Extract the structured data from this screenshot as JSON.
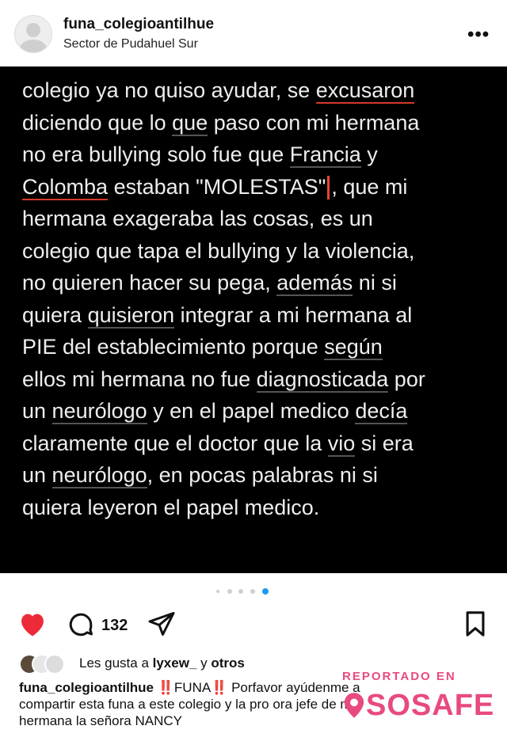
{
  "header": {
    "username": "funa_colegioantilhue",
    "location": "Sector de Pudahuel Sur",
    "more_label": "•••"
  },
  "post": {
    "lines": [
      [
        {
          "t": "colegio ya no quiso ayudar, se "
        },
        {
          "t": "excusaron",
          "s": "ur"
        }
      ],
      [
        {
          "t": "diciendo que lo "
        },
        {
          "t": "que",
          "s": "u"
        },
        {
          "t": " paso con mi hermana"
        }
      ],
      [
        {
          "t": "no era bullying solo fue que "
        },
        {
          "t": "Francia",
          "s": "u"
        },
        {
          "t": " y"
        }
      ],
      [
        {
          "t": "Colomba",
          "s": "ur"
        },
        {
          "t": " estaban \"MOLESTAS\""
        },
        {
          "t": "",
          "s": "cursor"
        },
        {
          "t": ", que mi"
        }
      ],
      [
        {
          "t": "hermana exageraba las cosas, es un"
        }
      ],
      [
        {
          "t": "colegio que tapa el bullying y la violencia,"
        }
      ],
      [
        {
          "t": "no quieren hacer su pega, "
        },
        {
          "t": "además",
          "s": "u"
        },
        {
          "t": " ni si"
        }
      ],
      [
        {
          "t": "quiera "
        },
        {
          "t": "quisieron",
          "s": "u"
        },
        {
          "t": " integrar a mi hermana al"
        }
      ],
      [
        {
          "t": "PIE del establecimiento porque "
        },
        {
          "t": "según",
          "s": "u"
        }
      ],
      [
        {
          "t": "ellos mi hermana no fue "
        },
        {
          "t": "diagnosticada",
          "s": "u"
        },
        {
          "t": " por"
        }
      ],
      [
        {
          "t": "un "
        },
        {
          "t": "neurólogo",
          "s": "u"
        },
        {
          "t": " y en el papel medico "
        },
        {
          "t": "decía",
          "s": "u"
        }
      ],
      [
        {
          "t": "claramente que el doctor que la "
        },
        {
          "t": "vio",
          "s": "u"
        },
        {
          "t": " si era"
        }
      ],
      [
        {
          "t": "un "
        },
        {
          "t": "neurólogo",
          "s": "u"
        },
        {
          "t": ", en pocas palabras ni si"
        }
      ],
      [
        {
          "t": "quiera leyeron el papel medico."
        }
      ]
    ]
  },
  "actions": {
    "comment_count": "132"
  },
  "likes": {
    "prefix": "Les gusta a ",
    "user": "lyxew_",
    "middle": " y ",
    "others": "otros"
  },
  "caption": {
    "username": "funa_colegioantilhue",
    "exclaim1": " ‼️",
    "funa": "FUNA",
    "exclaim2": "‼️",
    "text1": " Porfavor ayúdenme a",
    "line2": "compartir esta funa a este colegio y la pro     ora jefe de mi",
    "line3": "hermana la señora NANCY"
  },
  "watermark": {
    "top": "REPORTADO EN",
    "brand": "SOSAFE"
  },
  "colors": {
    "heart": "#ed2a3a",
    "accent_dot": "#1d9bf0",
    "watermark": "#e84a7f"
  }
}
